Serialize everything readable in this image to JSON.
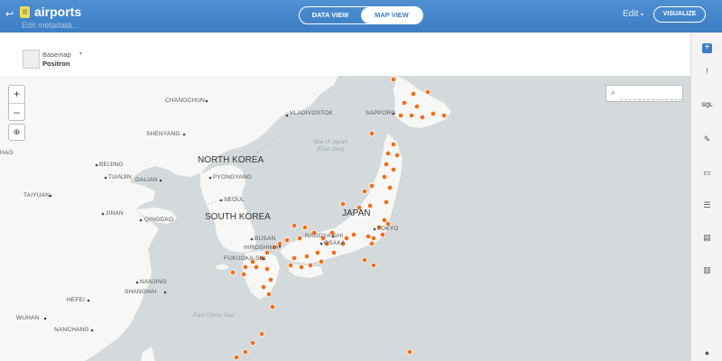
{
  "header": {
    "back_icon": "back-arrow-icon",
    "title": "airports",
    "metadata": "Edit metadata...",
    "tabs": [
      {
        "label": "DATA VIEW",
        "active": false
      },
      {
        "label": "MAP VIEW",
        "active": true
      }
    ],
    "edit_label": "Edit",
    "visualize_label": "VISUALIZE"
  },
  "basemap": {
    "label": "Basemap",
    "value": "Positron"
  },
  "map": {
    "zoom_in": "+",
    "zoom_out": "–",
    "share_icon": "share-icon",
    "search_icon": "search-icon",
    "countries": [
      "NORTH KOREA",
      "SOUTH KOREA",
      "JAPAN"
    ],
    "cities": [
      "CHANGCHUN",
      "VLADIVOSTOK",
      "SAPPORO",
      "SHENYANG",
      "BEIJING",
      "TIANJIN",
      "DALIAN",
      "PYONGYANG",
      "SEOUL",
      "TAIYUAN",
      "JINAN",
      "QINGDAO",
      "BUSAN",
      "HIROSHIMA",
      "NAGOYA-SHI",
      "OSAKA",
      "TOKYO",
      "FUKUOKA-SHI",
      "NANJING",
      "SHANGHAI",
      "HEFEI",
      "WUHAN",
      "NANCHANG",
      "HAO"
    ],
    "seas": [
      "Sea of Japan (East Sea)",
      "East China Sea"
    ],
    "accent": "#f26f20"
  },
  "rail": {
    "icons": [
      "add-layer-icon",
      "alert-icon",
      "sql-icon",
      "wizard-icon",
      "infowindow-icon",
      "legend-icon",
      "filter-icon",
      "chart-icon",
      "person-icon"
    ]
  }
}
